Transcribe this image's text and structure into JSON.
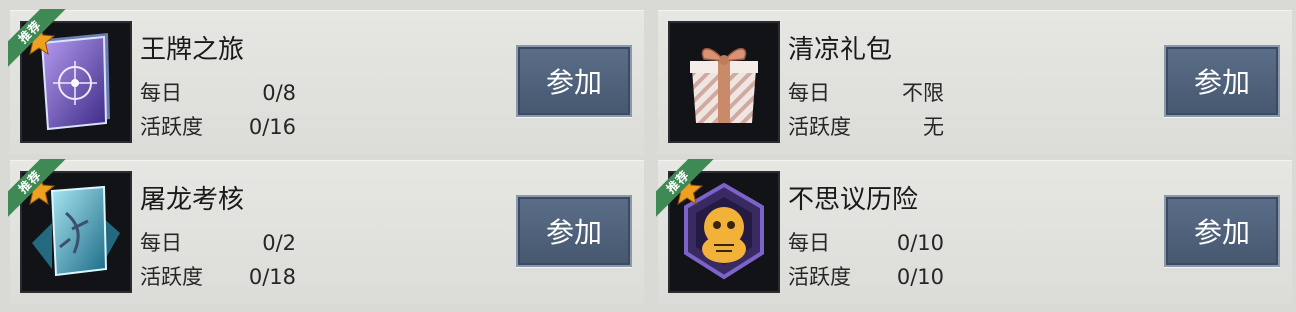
{
  "cards": [
    {
      "badge": "推荐",
      "title": "王牌之旅",
      "row1_label": "每日",
      "row1_value": "0/8",
      "row2_label": "活跃度",
      "row2_value": "0/16",
      "button": "参加",
      "icon": "ace-card-icon"
    },
    {
      "title": "清凉礼包",
      "row1_label": "每日",
      "row1_value": "不限",
      "row2_label": "活跃度",
      "row2_value": "无",
      "button": "参加",
      "icon": "gift-box-icon"
    },
    {
      "badge": "推荐",
      "title": "屠龙考核",
      "row1_label": "每日",
      "row1_value": "0/2",
      "row2_label": "活跃度",
      "row2_value": "0/18",
      "button": "参加",
      "icon": "dragon-card-icon"
    },
    {
      "badge": "推荐",
      "title": "不思议历险",
      "row1_label": "每日",
      "row1_value": "0/10",
      "row2_label": "活跃度",
      "row2_value": "0/10",
      "button": "参加",
      "icon": "daruma-emblem-icon"
    }
  ],
  "colors": {
    "badge": "#3f8a54",
    "button": "#4f6079",
    "star": "#f0a020"
  }
}
